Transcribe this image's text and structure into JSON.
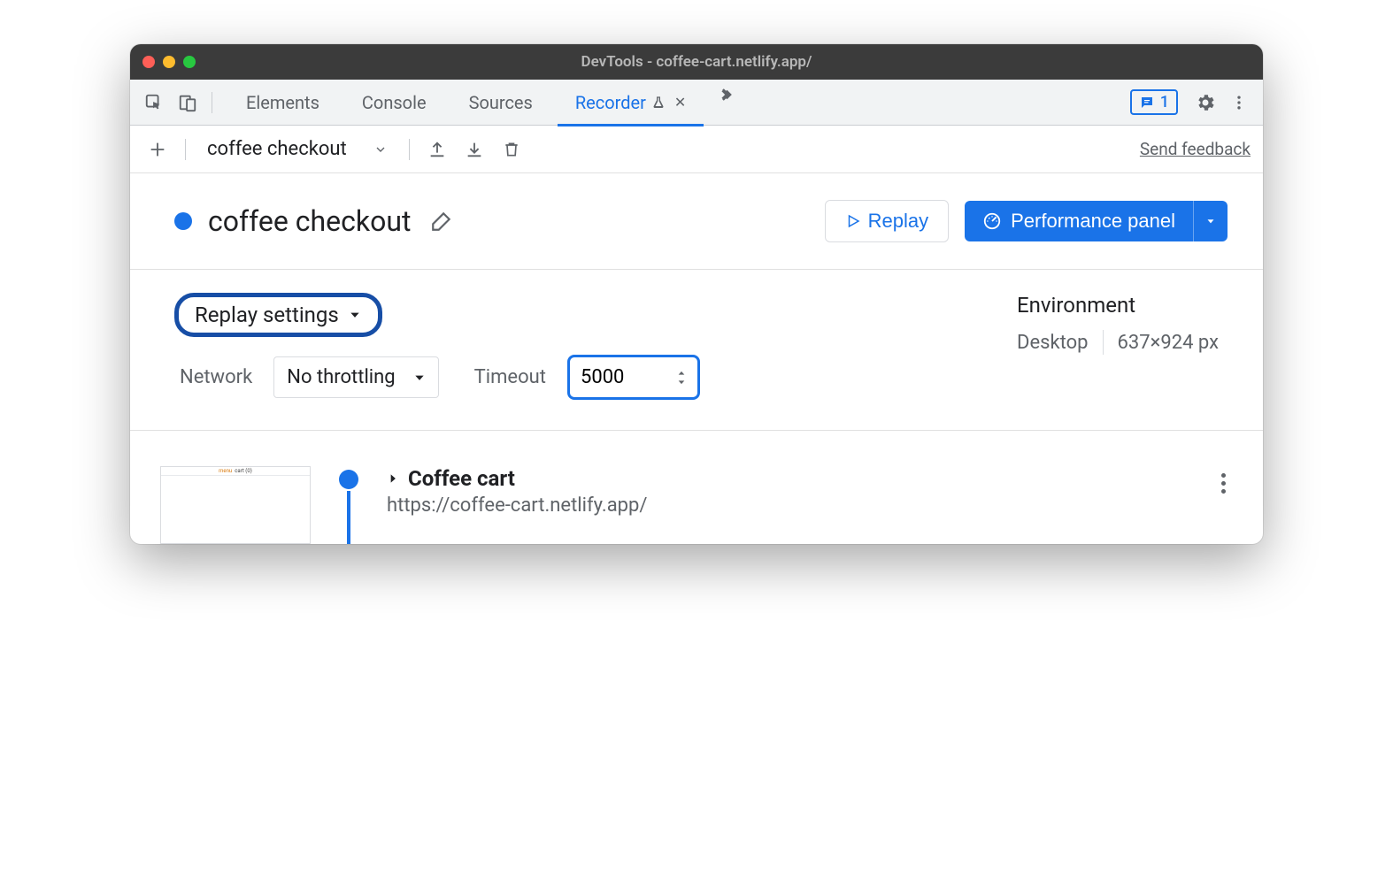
{
  "window": {
    "title": "DevTools - coffee-cart.netlify.app/"
  },
  "tabs": {
    "items": [
      "Elements",
      "Console",
      "Sources"
    ],
    "active": "Recorder",
    "issues_count": "1"
  },
  "toolbar": {
    "recording_name": "coffee checkout",
    "feedback": "Send feedback"
  },
  "header": {
    "title": "coffee checkout",
    "replay_label": "Replay",
    "perf_label": "Performance panel"
  },
  "settings": {
    "replay_settings_label": "Replay settings",
    "network_label": "Network",
    "network_value": "No throttling",
    "timeout_label": "Timeout",
    "timeout_value": "5000",
    "env_title": "Environment",
    "env_device": "Desktop",
    "env_dims": "637×924 px"
  },
  "step": {
    "title": "Coffee cart",
    "url": "https://coffee-cart.netlify.app/",
    "thumb_tabs": [
      "menu",
      "cart (0)"
    ]
  }
}
